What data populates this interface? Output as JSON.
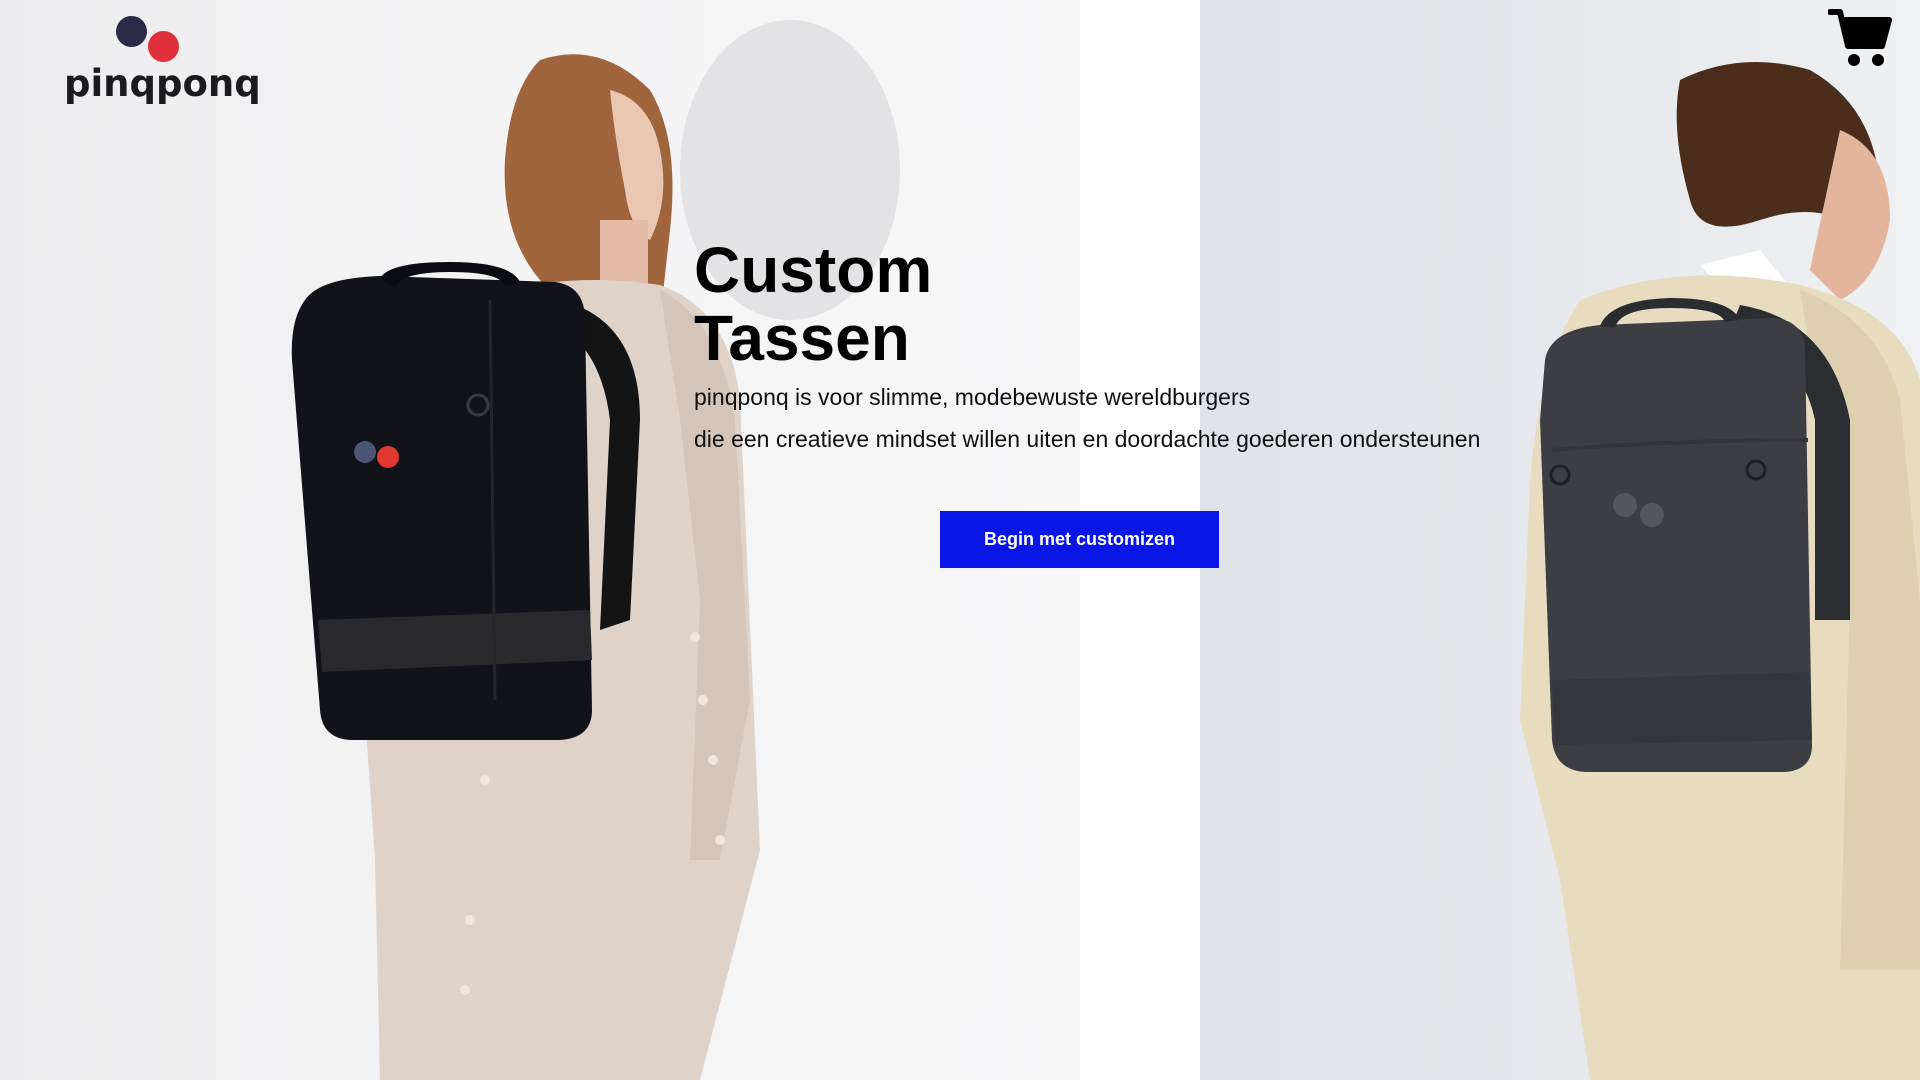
{
  "brand": {
    "logo_text": "pinqponq",
    "dot_colors": {
      "navy": "#2b2b47",
      "red": "#e0303b"
    }
  },
  "header": {
    "cart_icon": "shopping-cart-icon"
  },
  "hero": {
    "title_line1": "Custom",
    "title_line2": "Tassen",
    "subtitle_line1": "pinqponq is voor slimme, modebewuste wereldburgers",
    "subtitle_line2": "die een creatieve mindset willen uiten en doordachte goederen ondersteunen",
    "cta_label": "Begin met customizen"
  },
  "colors": {
    "cta_background": "#0a16e6",
    "cta_text": "#ffffff",
    "title": "#000000"
  },
  "images": {
    "left": "model-with-black-backpack",
    "right": "model-with-grey-backpack"
  }
}
